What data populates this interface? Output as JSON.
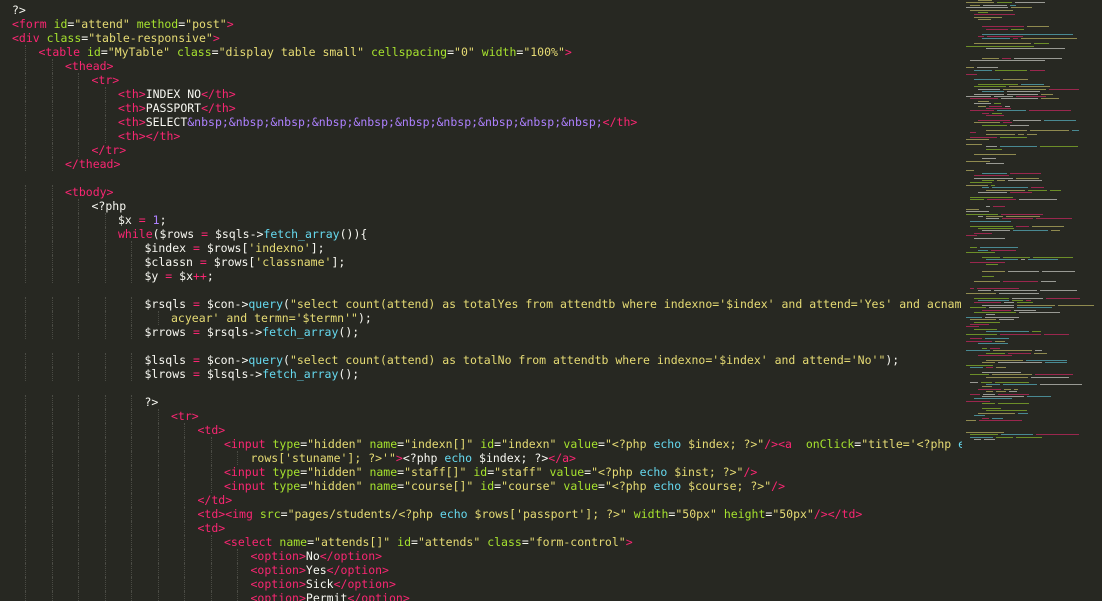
{
  "editor": {
    "theme": {
      "background": "#272822",
      "plain": "#f8f8f2",
      "tag": "#f92672",
      "attribute": "#a6e22e",
      "string": "#e6db74",
      "entity": "#ae81ff",
      "keyword": "#f92672",
      "function": "#66d9ef",
      "number": "#ae81ff",
      "guide": "#4a4b44"
    },
    "lines": [
      {
        "indent": 0,
        "tokens": [
          [
            "p",
            "?>"
          ]
        ]
      },
      {
        "indent": 0,
        "tokens": [
          [
            "t",
            "<form"
          ],
          [
            "p",
            " "
          ],
          [
            "a",
            "id"
          ],
          [
            "p",
            "="
          ],
          [
            "s",
            "\"attend\""
          ],
          [
            "p",
            " "
          ],
          [
            "a",
            "method"
          ],
          [
            "p",
            "="
          ],
          [
            "s",
            "\"post\""
          ],
          [
            "t",
            ">"
          ]
        ]
      },
      {
        "indent": 0,
        "tokens": [
          [
            "t",
            "<div"
          ],
          [
            "p",
            " "
          ],
          [
            "a",
            "class"
          ],
          [
            "p",
            "="
          ],
          [
            "s",
            "\"table-responsive\""
          ],
          [
            "t",
            ">"
          ]
        ]
      },
      {
        "indent": 1,
        "tokens": [
          [
            "t",
            "<table"
          ],
          [
            "p",
            " "
          ],
          [
            "a",
            "id"
          ],
          [
            "p",
            "="
          ],
          [
            "s",
            "\"MyTable\""
          ],
          [
            "p",
            " "
          ],
          [
            "a",
            "class"
          ],
          [
            "p",
            "="
          ],
          [
            "s",
            "\"display table small\""
          ],
          [
            "p",
            " "
          ],
          [
            "a",
            "cellspacing"
          ],
          [
            "p",
            "="
          ],
          [
            "s",
            "\"0\""
          ],
          [
            "p",
            " "
          ],
          [
            "a",
            "width"
          ],
          [
            "p",
            "="
          ],
          [
            "s",
            "\"100%\""
          ],
          [
            "t",
            ">"
          ]
        ]
      },
      {
        "indent": 2,
        "tokens": [
          [
            "t",
            "<thead>"
          ]
        ]
      },
      {
        "indent": 3,
        "tokens": [
          [
            "t",
            "<tr>"
          ]
        ]
      },
      {
        "indent": 4,
        "tokens": [
          [
            "t",
            "<th>"
          ],
          [
            "p",
            "INDEX NO"
          ],
          [
            "t",
            "</th>"
          ]
        ]
      },
      {
        "indent": 4,
        "tokens": [
          [
            "t",
            "<th>"
          ],
          [
            "p",
            "PASSPORT"
          ],
          [
            "t",
            "</th>"
          ]
        ]
      },
      {
        "indent": 4,
        "tokens": [
          [
            "t",
            "<th>"
          ],
          [
            "p",
            "SELECT"
          ],
          [
            "e",
            "&nbsp;&nbsp;&nbsp;&nbsp;&nbsp;&nbsp;&nbsp;&nbsp;&nbsp;&nbsp;"
          ],
          [
            "t",
            "</th>"
          ]
        ]
      },
      {
        "indent": 4,
        "tokens": [
          [
            "t",
            "<th></th>"
          ]
        ]
      },
      {
        "indent": 3,
        "tokens": [
          [
            "t",
            "</tr>"
          ]
        ]
      },
      {
        "indent": 2,
        "tokens": [
          [
            "t",
            "</thead>"
          ]
        ]
      },
      {
        "indent": 0,
        "tokens": []
      },
      {
        "indent": 2,
        "tokens": [
          [
            "t",
            "<tbody>"
          ]
        ]
      },
      {
        "indent": 3,
        "tokens": [
          [
            "p",
            "<?php"
          ]
        ]
      },
      {
        "indent": 4,
        "tokens": [
          [
            "p",
            "$x "
          ],
          [
            "k",
            "="
          ],
          [
            "p",
            " "
          ],
          [
            "n",
            "1"
          ],
          [
            "p",
            ";"
          ]
        ]
      },
      {
        "indent": 4,
        "tokens": [
          [
            "k",
            "while"
          ],
          [
            "p",
            "($rows "
          ],
          [
            "k",
            "="
          ],
          [
            "p",
            " $sqls->"
          ],
          [
            "f",
            "fetch_array"
          ],
          [
            "p",
            "()){"
          ]
        ]
      },
      {
        "indent": 5,
        "tokens": [
          [
            "p",
            "$index "
          ],
          [
            "k",
            "="
          ],
          [
            "p",
            " $rows["
          ],
          [
            "s",
            "'indexno'"
          ],
          [
            "p",
            "];"
          ]
        ]
      },
      {
        "indent": 5,
        "tokens": [
          [
            "p",
            "$classn "
          ],
          [
            "k",
            "="
          ],
          [
            "p",
            " $rows["
          ],
          [
            "s",
            "'classname'"
          ],
          [
            "p",
            "];"
          ]
        ]
      },
      {
        "indent": 5,
        "tokens": [
          [
            "p",
            "$y "
          ],
          [
            "k",
            "="
          ],
          [
            "p",
            " $x"
          ],
          [
            "k",
            "++"
          ],
          [
            "p",
            ";"
          ]
        ]
      },
      {
        "indent": 0,
        "tokens": []
      },
      {
        "indent": 5,
        "tokens": [
          [
            "p",
            "$rsqls "
          ],
          [
            "k",
            "="
          ],
          [
            "p",
            " $con->"
          ],
          [
            "f",
            "query"
          ],
          [
            "p",
            "("
          ],
          [
            "s",
            "\"select count(attend) as totalYes from attendtb where indexno='$index' and attend='Yes' and acname='$"
          ]
        ]
      },
      {
        "indent": 6,
        "tokens": [
          [
            "s",
            "acyear' and termn='$termn'\""
          ],
          [
            "p",
            ");"
          ]
        ]
      },
      {
        "indent": 5,
        "tokens": [
          [
            "p",
            "$rrows "
          ],
          [
            "k",
            "="
          ],
          [
            "p",
            " $rsqls->"
          ],
          [
            "f",
            "fetch_array"
          ],
          [
            "p",
            "();"
          ]
        ]
      },
      {
        "indent": 0,
        "tokens": []
      },
      {
        "indent": 5,
        "tokens": [
          [
            "p",
            "$lsqls "
          ],
          [
            "k",
            "="
          ],
          [
            "p",
            " $con->"
          ],
          [
            "f",
            "query"
          ],
          [
            "p",
            "("
          ],
          [
            "s",
            "\"select count(attend) as totalNo from attendtb where indexno='$index' and attend='No'\""
          ],
          [
            "p",
            ");"
          ]
        ]
      },
      {
        "indent": 5,
        "tokens": [
          [
            "p",
            "$lrows "
          ],
          [
            "k",
            "="
          ],
          [
            "p",
            " $lsqls->"
          ],
          [
            "f",
            "fetch_array"
          ],
          [
            "p",
            "();"
          ]
        ]
      },
      {
        "indent": 0,
        "tokens": []
      },
      {
        "indent": 5,
        "tokens": [
          [
            "p",
            "?>"
          ]
        ]
      },
      {
        "indent": 6,
        "tokens": [
          [
            "t",
            "<tr>"
          ]
        ]
      },
      {
        "indent": 7,
        "tokens": [
          [
            "t",
            "<td>"
          ]
        ]
      },
      {
        "indent": 8,
        "tokens": [
          [
            "t",
            "<input"
          ],
          [
            "p",
            " "
          ],
          [
            "a",
            "type"
          ],
          [
            "p",
            "="
          ],
          [
            "s",
            "\"hidden\""
          ],
          [
            "p",
            " "
          ],
          [
            "a",
            "name"
          ],
          [
            "p",
            "="
          ],
          [
            "s",
            "\"indexn[]\""
          ],
          [
            "p",
            " "
          ],
          [
            "a",
            "id"
          ],
          [
            "p",
            "="
          ],
          [
            "s",
            "\"indexn\""
          ],
          [
            "p",
            " "
          ],
          [
            "a",
            "value"
          ],
          [
            "p",
            "="
          ],
          [
            "s",
            "\"<?php "
          ],
          [
            "f",
            "echo"
          ],
          [
            "s",
            " $index; ?>\""
          ],
          [
            "t",
            "/>"
          ],
          [
            "t",
            "<a"
          ],
          [
            "p",
            "  "
          ],
          [
            "a",
            "onClick"
          ],
          [
            "p",
            "="
          ],
          [
            "s",
            "\"title='<?php "
          ],
          [
            "f",
            "echo"
          ],
          [
            "s",
            " $"
          ]
        ]
      },
      {
        "indent": 9,
        "tokens": [
          [
            "s",
            "rows['stuname']; ?>'\""
          ],
          [
            "t",
            ">"
          ],
          [
            "p",
            "<?php "
          ],
          [
            "f",
            "echo"
          ],
          [
            "p",
            " $index; ?>"
          ],
          [
            "t",
            "</a>"
          ]
        ]
      },
      {
        "indent": 8,
        "tokens": [
          [
            "t",
            "<input"
          ],
          [
            "p",
            " "
          ],
          [
            "a",
            "type"
          ],
          [
            "p",
            "="
          ],
          [
            "s",
            "\"hidden\""
          ],
          [
            "p",
            " "
          ],
          [
            "a",
            "name"
          ],
          [
            "p",
            "="
          ],
          [
            "s",
            "\"staff[]\""
          ],
          [
            "p",
            " "
          ],
          [
            "a",
            "id"
          ],
          [
            "p",
            "="
          ],
          [
            "s",
            "\"staff\""
          ],
          [
            "p",
            " "
          ],
          [
            "a",
            "value"
          ],
          [
            "p",
            "="
          ],
          [
            "s",
            "\"<?php "
          ],
          [
            "f",
            "echo"
          ],
          [
            "s",
            " $inst; ?>\""
          ],
          [
            "t",
            "/>"
          ]
        ]
      },
      {
        "indent": 8,
        "tokens": [
          [
            "t",
            "<input"
          ],
          [
            "p",
            " "
          ],
          [
            "a",
            "type"
          ],
          [
            "p",
            "="
          ],
          [
            "s",
            "\"hidden\""
          ],
          [
            "p",
            " "
          ],
          [
            "a",
            "name"
          ],
          [
            "p",
            "="
          ],
          [
            "s",
            "\"course[]\""
          ],
          [
            "p",
            " "
          ],
          [
            "a",
            "id"
          ],
          [
            "p",
            "="
          ],
          [
            "s",
            "\"course\""
          ],
          [
            "p",
            " "
          ],
          [
            "a",
            "value"
          ],
          [
            "p",
            "="
          ],
          [
            "s",
            "\"<?php "
          ],
          [
            "f",
            "echo"
          ],
          [
            "s",
            " $course; ?>\""
          ],
          [
            "t",
            "/>"
          ]
        ]
      },
      {
        "indent": 7,
        "tokens": [
          [
            "t",
            "</td>"
          ]
        ]
      },
      {
        "indent": 7,
        "tokens": [
          [
            "t",
            "<td>"
          ],
          [
            "t",
            "<img"
          ],
          [
            "p",
            " "
          ],
          [
            "a",
            "src"
          ],
          [
            "p",
            "="
          ],
          [
            "s",
            "\"pages/students/<?php "
          ],
          [
            "f",
            "echo"
          ],
          [
            "s",
            " $rows['passport']; ?>\""
          ],
          [
            "p",
            " "
          ],
          [
            "a",
            "width"
          ],
          [
            "p",
            "="
          ],
          [
            "s",
            "\"50px\""
          ],
          [
            "p",
            " "
          ],
          [
            "a",
            "height"
          ],
          [
            "p",
            "="
          ],
          [
            "s",
            "\"50px\""
          ],
          [
            "t",
            "/></td>"
          ]
        ]
      },
      {
        "indent": 7,
        "tokens": [
          [
            "t",
            "<td>"
          ]
        ]
      },
      {
        "indent": 8,
        "tokens": [
          [
            "t",
            "<select"
          ],
          [
            "p",
            " "
          ],
          [
            "a",
            "name"
          ],
          [
            "p",
            "="
          ],
          [
            "s",
            "\"attends[]\""
          ],
          [
            "p",
            " "
          ],
          [
            "a",
            "id"
          ],
          [
            "p",
            "="
          ],
          [
            "s",
            "\"attends\""
          ],
          [
            "p",
            " "
          ],
          [
            "a",
            "class"
          ],
          [
            "p",
            "="
          ],
          [
            "s",
            "\"form-control\""
          ],
          [
            "t",
            ">"
          ]
        ]
      },
      {
        "indent": 9,
        "tokens": [
          [
            "t",
            "<option>"
          ],
          [
            "p",
            "No"
          ],
          [
            "t",
            "</option>"
          ]
        ]
      },
      {
        "indent": 9,
        "tokens": [
          [
            "t",
            "<option>"
          ],
          [
            "p",
            "Yes"
          ],
          [
            "t",
            "</option>"
          ]
        ]
      },
      {
        "indent": 9,
        "tokens": [
          [
            "t",
            "<option>"
          ],
          [
            "p",
            "Sick"
          ],
          [
            "t",
            "</option>"
          ]
        ]
      },
      {
        "indent": 9,
        "tokens": [
          [
            "t",
            "<option>"
          ],
          [
            "p",
            "Permit"
          ],
          [
            "t",
            "</option>"
          ]
        ]
      }
    ]
  }
}
